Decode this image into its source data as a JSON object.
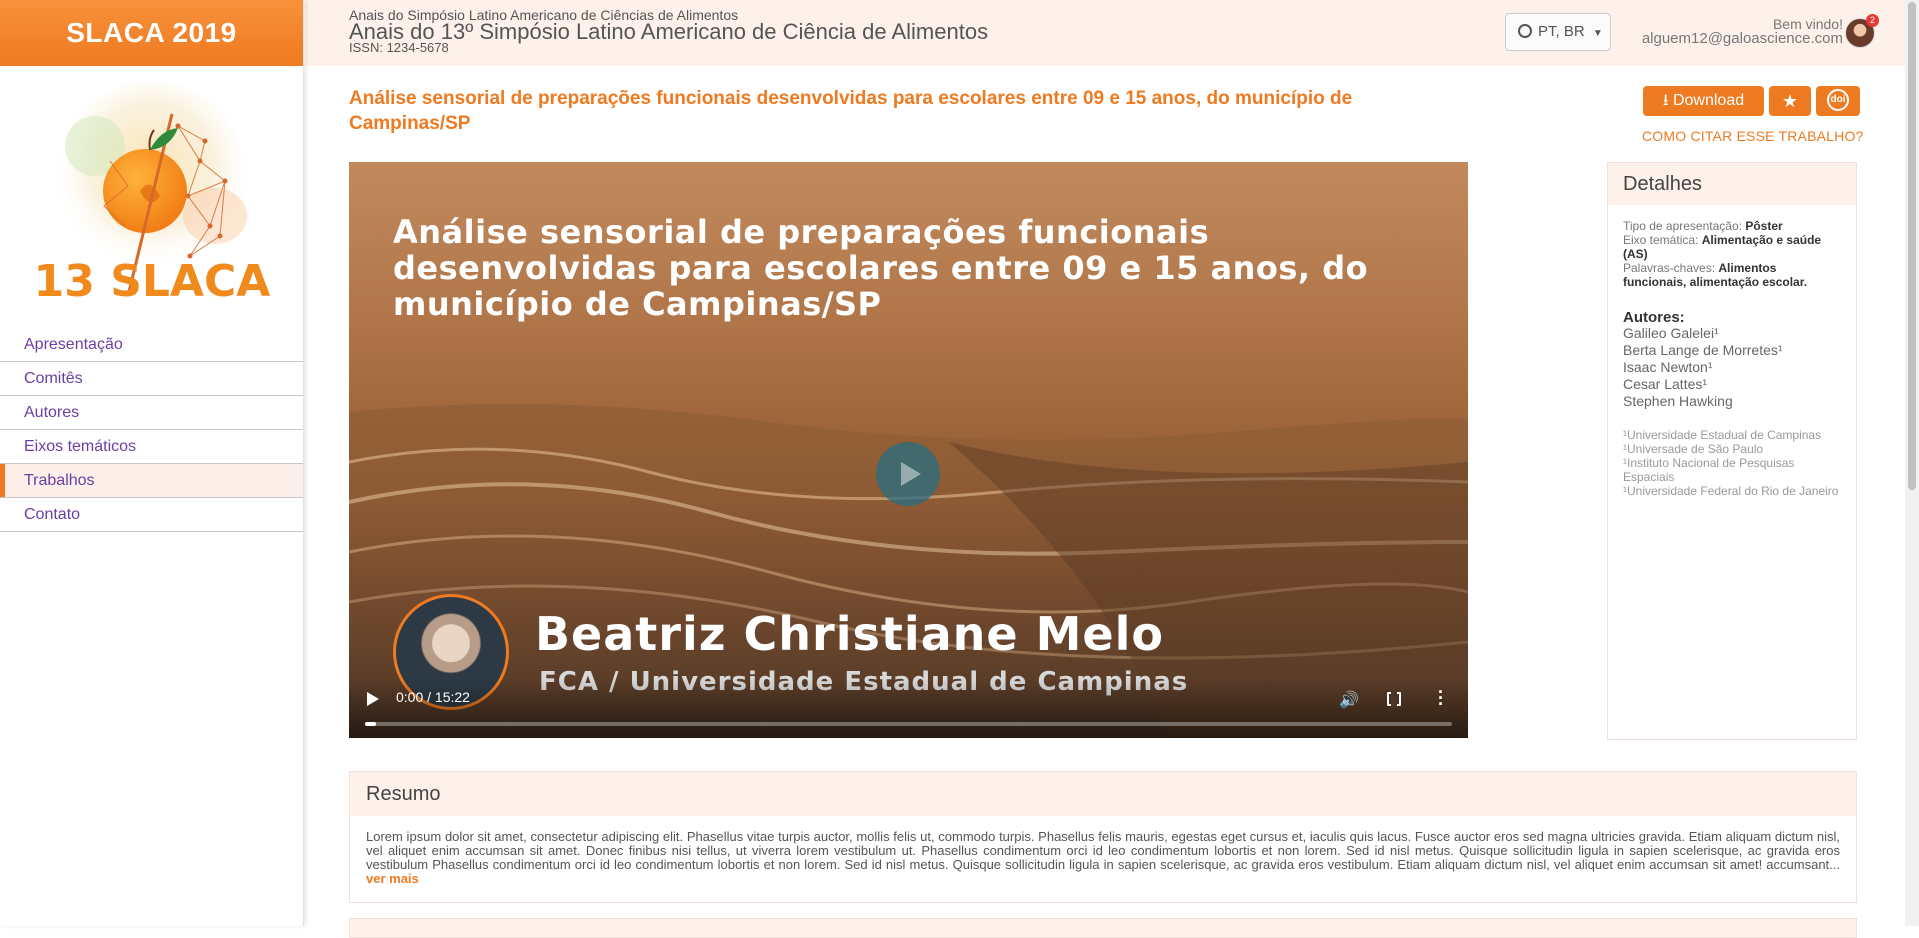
{
  "sidebar": {
    "brand": "SLACA 2019",
    "logo_text": "13 SLACA",
    "nav": [
      {
        "label": "Apresentação"
      },
      {
        "label": "Comitês"
      },
      {
        "label": "Autores"
      },
      {
        "label": "Eixos temáticos"
      },
      {
        "label": "Trabalhos"
      },
      {
        "label": "Contato"
      }
    ],
    "active_item": "Trabalhos"
  },
  "header": {
    "subtitle": "Anais do Simpósio Latino Americano de Ciências de Alimentos",
    "title": "Anais do 13º Simpósio Latino Americano de Ciência de Alimentos",
    "issn": "ISSN: 1234-5678",
    "language": "PT, BR",
    "greeting": "Bem vindo!",
    "email": "alguem12@galoascience.com",
    "notifications": "2"
  },
  "paper": {
    "title": "Análise sensorial de preparações funcionais desenvolvidas para escolares entre 09 e 15 anos, do município de Campinas/SP",
    "download_label": "Download",
    "doi_label": "doi",
    "cite_label": "COMO CITAR ESSE TRABALHO?"
  },
  "video": {
    "title": "Análise sensorial de preparações funcionais desenvolvidas para escolares entre 09 e 15 anos, do município de Campinas/SP",
    "presenter": "Beatriz Christiane Melo",
    "institution": "FCA / Universidade Estadual de Campinas",
    "time": "0:00 / 15:22",
    "progress": 0.01
  },
  "details": {
    "heading": "Detalhes",
    "tipo_label": "Tipo de apresentação:",
    "tipo_value": "Pôster",
    "eixo_label": "Eixo temática:",
    "eixo_value": "Alimentação e saúde (AS)",
    "palavras_label": "Palavras-chaves:",
    "palavras_value": "Alimentos funcionais, alimentação escolar.",
    "authors_heading": "Autores:",
    "authors": [
      "Galileo Galelei¹",
      "Berta Lange de Morretes¹",
      "Isaac Newton¹",
      "Cesar Lattes¹",
      "Stephen Hawking"
    ],
    "affiliations": [
      "¹Universidade Estadual de Campinas",
      "¹Universade de São Paulo",
      "¹Instituto Nacional de Pesquisas Espaciais",
      "¹Universidade Federal do Rio de Janeiro"
    ]
  },
  "resumo": {
    "heading": "Resumo",
    "text": "Lorem ipsum dolor sit amet, consectetur adipiscing elit. Phasellus vitae turpis auctor, mollis felis ut, commodo turpis. Phasellus felis mauris, egestas eget cursus et, iaculis quis lacus. Fusce auctor eros sed magna ultricies gravida. Etiam aliquam dictum nisl, vel aliquet enim accumsan sit amet. Donec finibus nisi tellus, ut viverra lorem vestibulum ut. Phasellus condimentum orci id leo condimentum lobortis et non lorem. Sed id nisl metus. Quisque sollicitudin ligula in sapien scelerisque, ac gravida eros vestibulum Phasellus condimentum orci id leo condimentum lobortis et non lorem. Sed id nisl metus. Quisque sollicitudin ligula in sapien scelerisque, ac gravida eros vestibulum. Etiam aliquam dictum nisl, vel aliquet enim accumsan sit amet! accumsant...",
    "more": "ver mais"
  },
  "colors": {
    "accent": "#ee7a21",
    "nav_text": "#6b3fa0",
    "header_bg": "#fdf1ea"
  }
}
